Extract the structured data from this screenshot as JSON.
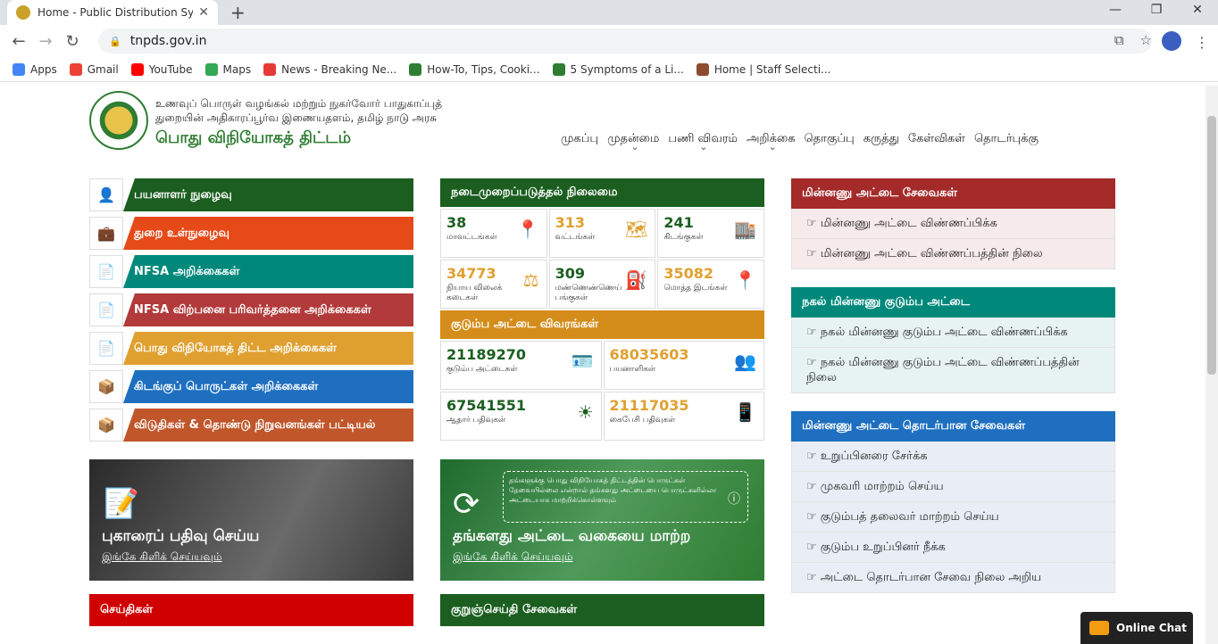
{
  "browser": {
    "tab_title": "Home - Public Distribution Syste",
    "url": "tnpds.gov.in",
    "bookmarks": [
      {
        "label": "Apps",
        "color": "#4285f4"
      },
      {
        "label": "Gmail",
        "color": "#ea4335"
      },
      {
        "label": "YouTube",
        "color": "#ff0000"
      },
      {
        "label": "Maps",
        "color": "#34a853"
      },
      {
        "label": "News - Breaking Ne...",
        "color": "#e53935"
      },
      {
        "label": "How-To, Tips, Cooki...",
        "color": "#2e7d32"
      },
      {
        "label": "5 Symptoms of a Li...",
        "color": "#2e7d32"
      },
      {
        "label": "Home | Staff Selecti...",
        "color": "#8d4b2f"
      }
    ]
  },
  "header": {
    "line1": "உணவுப் பொருள் வழங்கல் மற்றும் நுகர்வோர் பாதுகாப்புத்",
    "line2": "துறையின் அதிகாரப்பூர்வ இணையதளம், தமிழ் நாடு அரசு",
    "title": "பொது விநியோகத் திட்டம்",
    "nav": [
      "முகப்பு",
      "முதன்மை",
      "பணி விவரம்",
      "அறிக்கை",
      "தொகுப்பு",
      "கருத்து",
      "கேள்விகள்",
      "தொடர்புக்கு"
    ]
  },
  "left_menu": [
    {
      "label": "பயனாளர் நுழைவு",
      "color": "#1b5e20",
      "icon": "👤"
    },
    {
      "label": "துறை உள்நுழைவு",
      "color": "#e64a19",
      "icon": "💼"
    },
    {
      "label": "NFSA அறிக்கைகள்",
      "color": "#00897b",
      "icon": "📄"
    },
    {
      "label": "NFSA விற்பனை பரிவர்த்தனை அறிக்கைகள்",
      "color": "#b23a3a",
      "icon": "📄"
    },
    {
      "label": "பொது விநியோகத் திட்ட அறிக்கைகள்",
      "color": "#e0a030",
      "icon": "📄"
    },
    {
      "label": "கிடங்குப் பொருட்கள் அறிக்கைகள்",
      "color": "#1e6fc0",
      "icon": "📦"
    },
    {
      "label": "விடுதிகள் & தொண்டு நிறுவனங்கள் பட்டியல்",
      "color": "#c0562a",
      "icon": "📦"
    }
  ],
  "stats": {
    "title": "நடைமுறைப்படுத்தல் நிலைமை",
    "color": "#1b5e20",
    "cells": [
      {
        "num": "38",
        "cap": "மாவட்டங்கள்",
        "c": "#1b5e20",
        "icon": "📍"
      },
      {
        "num": "313",
        "cap": "வட்டங்கள்",
        "c": "#e0a030",
        "icon": "🗺"
      },
      {
        "num": "241",
        "cap": "கிடங்குகள்",
        "c": "#1b5e20",
        "icon": "🏬"
      },
      {
        "num": "34773",
        "cap": "நியாய விலைக் கடைகள்",
        "c": "#e0a030",
        "icon": "⚖"
      },
      {
        "num": "309",
        "cap": "மண்ணெண்ணெய் பங்குகள்",
        "c": "#1b5e20",
        "icon": "⛽"
      },
      {
        "num": "35082",
        "cap": "மொத்த இடங்கள்",
        "c": "#e0a030",
        "icon": "📍"
      }
    ]
  },
  "family": {
    "title": "குடும்ப அட்டை விவரங்கள்",
    "color": "#d48d1a",
    "cells": [
      {
        "num": "21189270",
        "cap": "குடும்ப அட்டைகள்",
        "c": "#1b5e20",
        "icon": "🪪"
      },
      {
        "num": "68035603",
        "cap": "பயனாளிகள்",
        "c": "#e0a030",
        "icon": "👥"
      },
      {
        "num": "67541551",
        "cap": "ஆதார் பதிவுகள்",
        "c": "#1b5e20",
        "icon": "☀"
      },
      {
        "num": "21117035",
        "cap": "கைபேசி பதிவுகள்",
        "c": "#e0a030",
        "icon": "📱"
      }
    ]
  },
  "right": {
    "box1": {
      "title": "மின்னணு அட்டை சேவைகள்",
      "color": "#a52a2a",
      "bg": "#f7eaea",
      "items": [
        "☞ மின்னணு அட்டை விண்ணப்பிக்க",
        "☞ மின்னணு அட்டை விண்ணப்பத்தின் நிலை"
      ]
    },
    "box2": {
      "title": "நகல் மின்னணு குடும்ப அட்டை",
      "color": "#00897b",
      "bg": "#e7f3f2",
      "items": [
        "☞ நகல் மின்னணு குடும்ப அட்டை விண்ணப்பிக்க",
        "☞ நகல் மின்னணு குடும்ப அட்டை விண்ணப்பத்தின் நிலை"
      ]
    },
    "box3": {
      "title": "மின்னணு அட்டை தொடர்பான சேவைகள்",
      "color": "#1e6fc0",
      "bg": "#e9eef6",
      "items": [
        "☞ உறுப்பினரை சேர்க்க",
        "☞ முகவரி மாற்றம் செய்ய",
        "☞ குடும்பத் தலைவர் மாற்றம் செய்ய",
        "☞ குடும்ப உறுப்பினர் நீக்க",
        "☞ அட்டை தொடர்பான சேவை நிலை அறிய"
      ]
    }
  },
  "banners": {
    "complaint_title": "புகாரைப் பதிவு செய்ய",
    "complaint_link": "இங்கே கிளிக் செய்யவும்",
    "change_title": "தங்களது அட்டை வகையை மாற்ற",
    "change_link": "இங்கே கிளிக் செய்யவும்",
    "change_note": "தங்களுக்கு பொது விநியோகத் திட்டத்தின் பொருட்கள் தேவையில்லை என்றால் தங்களது அட்டையை பொருட்களில்லா அட்டையாக மாற்றிக்கொள்ளவும்"
  },
  "news": {
    "news_title": "செய்திகள்",
    "sms_title": "குறுஞ்செய்தி சேவைகள்"
  },
  "chat": "Online Chat"
}
